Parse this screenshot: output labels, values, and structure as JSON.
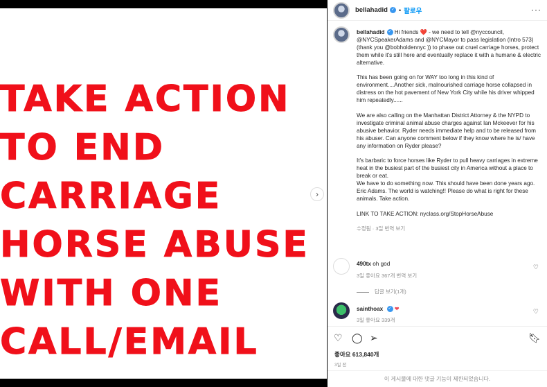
{
  "post": {
    "poster_lines": [
      "TAKE ACTION",
      "TO END",
      "CARRIAGE",
      "HORSE ABUSE",
      "WITH ONE",
      "CALL/EMAIL"
    ]
  },
  "header": {
    "username": "bellahadid",
    "follow_label": "팔로우",
    "more_label": "···"
  },
  "caption": {
    "username": "bellahadid",
    "paragraphs": [
      "Hi friends ❤️ - we need to tell @nyccouncil, @NYCSpeakerAdams and @NYCMayor to pass legislation (Intro 573) (thank you @bobholdennyc )) to phase out cruel carriage horses, protect them while it's still here and eventually replace it with a humane & electric alternative.",
      "This has been going on for WAY too long in this kind of environment....Another sick, malnourished carriage horse collapsed in distress on the hot pavement of New York City while his driver whipped him repeatedly......",
      "We are also calling on the Manhattan District Attorney & the NYPD to investigate criminal animal abuse charges against Ian Mckeever for his abusive behavior. Ryder needs immediate help and to be released from his abuser. Can anyone comment below if they know where he is/ have any information on Ryder please?",
      "It's barbaric to force horses like Ryder to pull heavy carriages in extreme heat in the busiest part of the busiest city in America without a place to break or eat.\nWe have to do something now. This should have been done years ago. Eric Adams. The world is watching!! Please do what is right for these animals. Take action.",
      "LINK TO TAKE ACTION: nyclass.org/StopHorseAbuse"
    ],
    "meta": "수정됨 · 3일    번역 보기"
  },
  "comments": [
    {
      "username": "490tx",
      "text": "oh god",
      "meta": "3일    좋아요 367개    번역 보기",
      "replies": "답글 보기(1개)"
    },
    {
      "username": "sainthoax",
      "text": "❤",
      "meta": "3일    좋아요 339개"
    }
  ],
  "likes": "좋아요 613,840개",
  "time_ago": "3일 전",
  "comments_closed": "이 게시물에 대한 댓글 기능이 제한되었습니다."
}
